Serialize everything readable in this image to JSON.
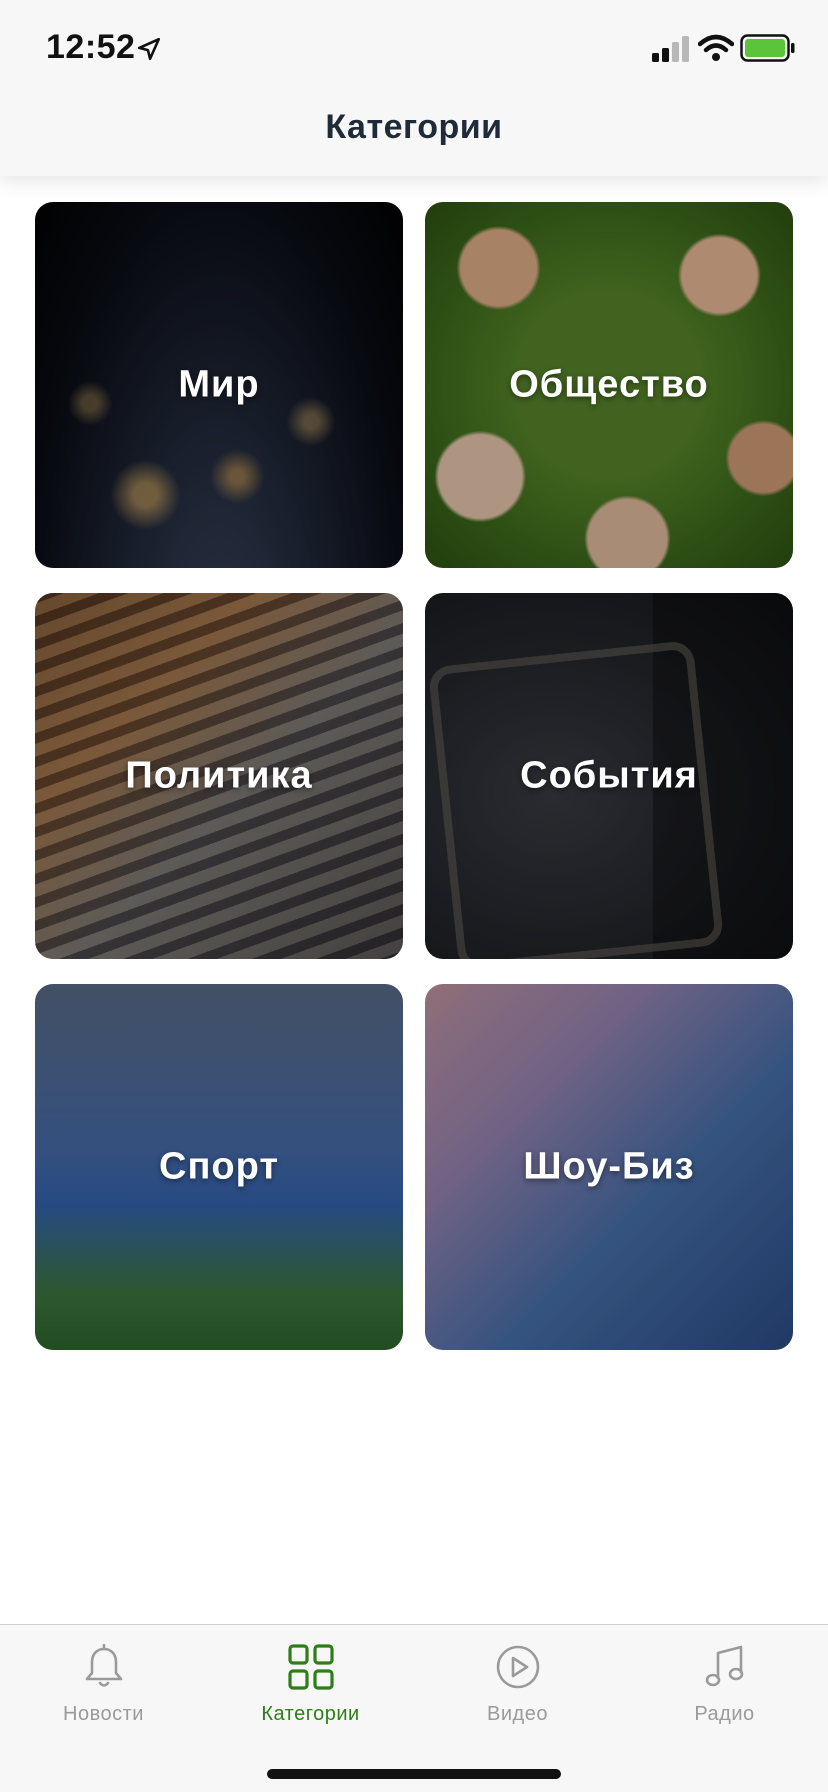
{
  "status_bar": {
    "time": "12:52",
    "icons": [
      "location-arrow-icon",
      "cellular-signal-icon",
      "wifi-icon",
      "battery-icon"
    ],
    "battery_color": "#5cc43a"
  },
  "header": {
    "title": "Категории"
  },
  "categories": [
    {
      "label": "Мир",
      "image": "earth-at-night"
    },
    {
      "label": "Общество",
      "image": "children-on-grass"
    },
    {
      "label": "Политика",
      "image": "parliament-hall"
    },
    {
      "label": "События",
      "image": "riot-police-shield"
    },
    {
      "label": "Спорт",
      "image": "football-match"
    },
    {
      "label": "Шоу-Биз",
      "image": "singer-with-microphone"
    }
  ],
  "tabbar": {
    "active_color": "#2e7d18",
    "inactive_color": "#9a9a9a",
    "tabs": [
      {
        "label": "Новости",
        "icon": "bell-icon",
        "active": false
      },
      {
        "label": "Категории",
        "icon": "grid-icon",
        "active": true
      },
      {
        "label": "Видео",
        "icon": "play-circle-icon",
        "active": false
      },
      {
        "label": "Радио",
        "icon": "music-note-icon",
        "active": false
      }
    ]
  }
}
